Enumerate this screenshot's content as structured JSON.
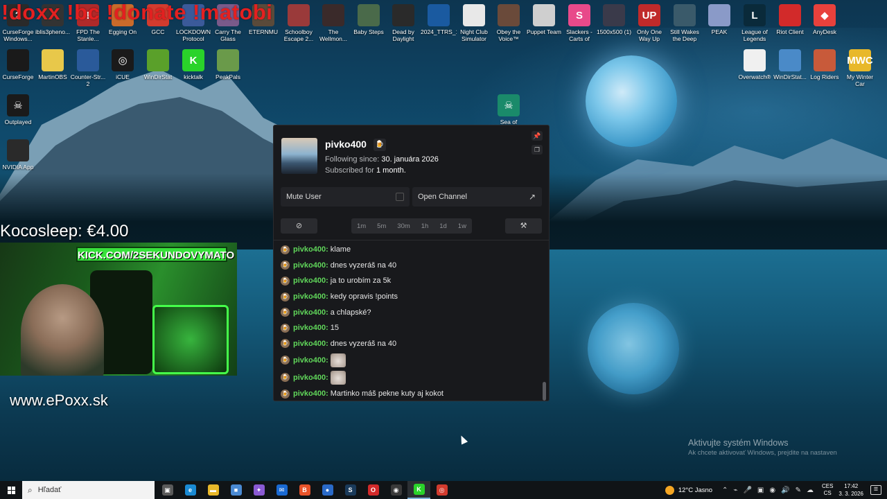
{
  "overlay": {
    "commands": "!doxx !bc !donate !matobi",
    "donation": "Kocosleep: €4.00",
    "webcam_banner": "KICK.COM/2SEKUNDOVYMATO",
    "site": "www.ePoxx.sk"
  },
  "desktop_icons": [
    {
      "label": "CurseForge Windows...",
      "color": "#2a2a2a",
      "glyph": "2"
    },
    {
      "label": "iblis3pheno...",
      "color": "#333",
      "glyph": ""
    },
    {
      "label": "FPD The Stanle...",
      "color": "#b02a2a",
      "glyph": "!"
    },
    {
      "label": "Egging On",
      "color": "#c96a2a",
      "glyph": ""
    },
    {
      "label": "GCC",
      "color": "#d23b2e",
      "glyph": ""
    },
    {
      "label": "LOCKDOWN Protocol",
      "color": "#3b5a9a",
      "glyph": ""
    },
    {
      "label": "Carry The Glass",
      "color": "#7a5a8a",
      "glyph": ""
    },
    {
      "label": "ETERNMU",
      "color": "#5a4a3a",
      "glyph": ""
    },
    {
      "label": "Schoolboy Escape 2...",
      "color": "#9a3a3a",
      "glyph": ""
    },
    {
      "label": "The Wellmon...",
      "color": "#3a2a2a",
      "glyph": ""
    },
    {
      "label": "Baby Steps",
      "color": "#4a6a4a",
      "glyph": ""
    },
    {
      "label": "Dead by Daylight",
      "color": "#2a2a2a",
      "glyph": ""
    },
    {
      "label": "2024_TTRS_1",
      "color": "#1a5aa0",
      "glyph": ""
    },
    {
      "label": "Night Club Simulator",
      "color": "#e8e8e8",
      "glyph": ""
    },
    {
      "label": "Obey the Voice™",
      "color": "#6a4a3a",
      "glyph": ""
    },
    {
      "label": "Puppet Team",
      "color": "#cfcfcf",
      "glyph": ""
    },
    {
      "label": "Slackers - Carts of Glory",
      "color": "#e84a8a",
      "glyph": "S"
    },
    {
      "label": "1500x500 (1)",
      "color": "#3a3a4a",
      "glyph": ""
    },
    {
      "label": "Only One Way Up",
      "color": "#c02a2a",
      "glyph": "UP"
    },
    {
      "label": "Still Wakes the Deep",
      "color": "#3a5a6a",
      "glyph": ""
    },
    {
      "label": "PEAK",
      "color": "#8a9ac8",
      "glyph": ""
    },
    {
      "label": "League of Legends",
      "color": "#0a2a3a",
      "glyph": "L"
    },
    {
      "label": "Riot Client",
      "color": "#d22a2a",
      "glyph": ""
    },
    {
      "label": "AnyDesk",
      "color": "#e8413c",
      "glyph": "◆"
    },
    {
      "label": "CurseForge",
      "color": "#1a1a1a",
      "glyph": ""
    },
    {
      "label": "MartinOBS",
      "color": "#e8c84a",
      "glyph": ""
    },
    {
      "label": "Counter-Str... 2",
      "color": "#2a5a9a",
      "glyph": ""
    },
    {
      "label": "iCUE",
      "color": "#1a1a1a",
      "glyph": "◎"
    },
    {
      "label": "WinDirStat",
      "color": "#5aa02a",
      "glyph": ""
    },
    {
      "label": "kicktalk",
      "color": "#2ad32a",
      "glyph": "K"
    },
    {
      "label": "PeakPals",
      "color": "#6a9a4a",
      "glyph": ""
    },
    {
      "label": "Overwatch®",
      "color": "#f0f0f0",
      "glyph": ""
    },
    {
      "label": "WinDirStat...",
      "color": "#4a8ac8",
      "glyph": ""
    },
    {
      "label": "Log Riders",
      "color": "#c85a3a",
      "glyph": ""
    },
    {
      "label": "My Winter Car",
      "color": "#e8b82a",
      "glyph": "MWC"
    },
    {
      "label": "Outplayed",
      "color": "#1a1a1a",
      "glyph": "☠"
    },
    {
      "label": "Sea of",
      "color": "#1a8a6a",
      "glyph": "☠"
    },
    {
      "label": "NVIDIA App",
      "color": "#2a2a2a",
      "glyph": ""
    }
  ],
  "popup": {
    "username": "pivko400",
    "following_prefix": "Following since:",
    "following_date": "30. januára 2026",
    "subscribed_prefix": "Subscribed for",
    "subscribed_value": "1 month.",
    "mute_label": "Mute User",
    "open_channel_label": "Open Channel",
    "timeouts": [
      "1m",
      "5m",
      "30m",
      "1h",
      "1d",
      "1w"
    ],
    "messages": [
      {
        "user": "pivko400:",
        "text": "klame",
        "emote": false
      },
      {
        "user": "pivko400:",
        "text": "dnes vyzeráš na 40",
        "emote": false
      },
      {
        "user": "pivko400:",
        "text": "ja to urobím za 5k",
        "emote": false
      },
      {
        "user": "pivko400:",
        "text": "kedy opravis !points",
        "emote": false
      },
      {
        "user": "pivko400:",
        "text": "a chlapské?",
        "emote": false
      },
      {
        "user": "pivko400:",
        "text": "15",
        "emote": false
      },
      {
        "user": "pivko400:",
        "text": "dnes vyzeráš na 40",
        "emote": false
      },
      {
        "user": "pivko400:",
        "text": "",
        "emote": true
      },
      {
        "user": "pivko400:",
        "text": "",
        "emote": true
      },
      {
        "user": "pivko400:",
        "text": "Martinko máš pekne kuty aj kokot",
        "emote": false
      }
    ]
  },
  "watermark": {
    "title": "Aktivujte systém Windows",
    "subtitle": "Ak chcete aktivovať Windows, prejdite na nastaven"
  },
  "taskbar": {
    "search_placeholder": "Hľadať",
    "weather": "12°C  Jasno",
    "lang_top": "CES",
    "lang_bottom": "CS",
    "time": "17:42",
    "date": "3. 3. 2026",
    "apps": [
      {
        "name": "task-view",
        "color": "#5a5a5a",
        "glyph": "▣"
      },
      {
        "name": "edge",
        "color": "#1a8ad3",
        "glyph": "e"
      },
      {
        "name": "file-explorer",
        "color": "#e8b82a",
        "glyph": "▬"
      },
      {
        "name": "store",
        "color": "#4a8ad3",
        "glyph": "■"
      },
      {
        "name": "copilot",
        "color": "#8a5ad3",
        "glyph": "✦"
      },
      {
        "name": "mail",
        "color": "#1a6ad3",
        "glyph": "✉"
      },
      {
        "name": "brave",
        "color": "#e8532a",
        "glyph": "B"
      },
      {
        "name": "app-blue",
        "color": "#2a6ac8",
        "glyph": "●"
      },
      {
        "name": "steam",
        "color": "#1a3a5a",
        "glyph": "S"
      },
      {
        "name": "opera",
        "color": "#d22a2a",
        "glyph": "O"
      },
      {
        "name": "obs",
        "color": "#3a3a3a",
        "glyph": "◉"
      },
      {
        "name": "kicktalk",
        "color": "#2ad32a",
        "glyph": "K"
      },
      {
        "name": "chrome-like",
        "color": "#d23b2e",
        "glyph": "◎"
      }
    ]
  }
}
